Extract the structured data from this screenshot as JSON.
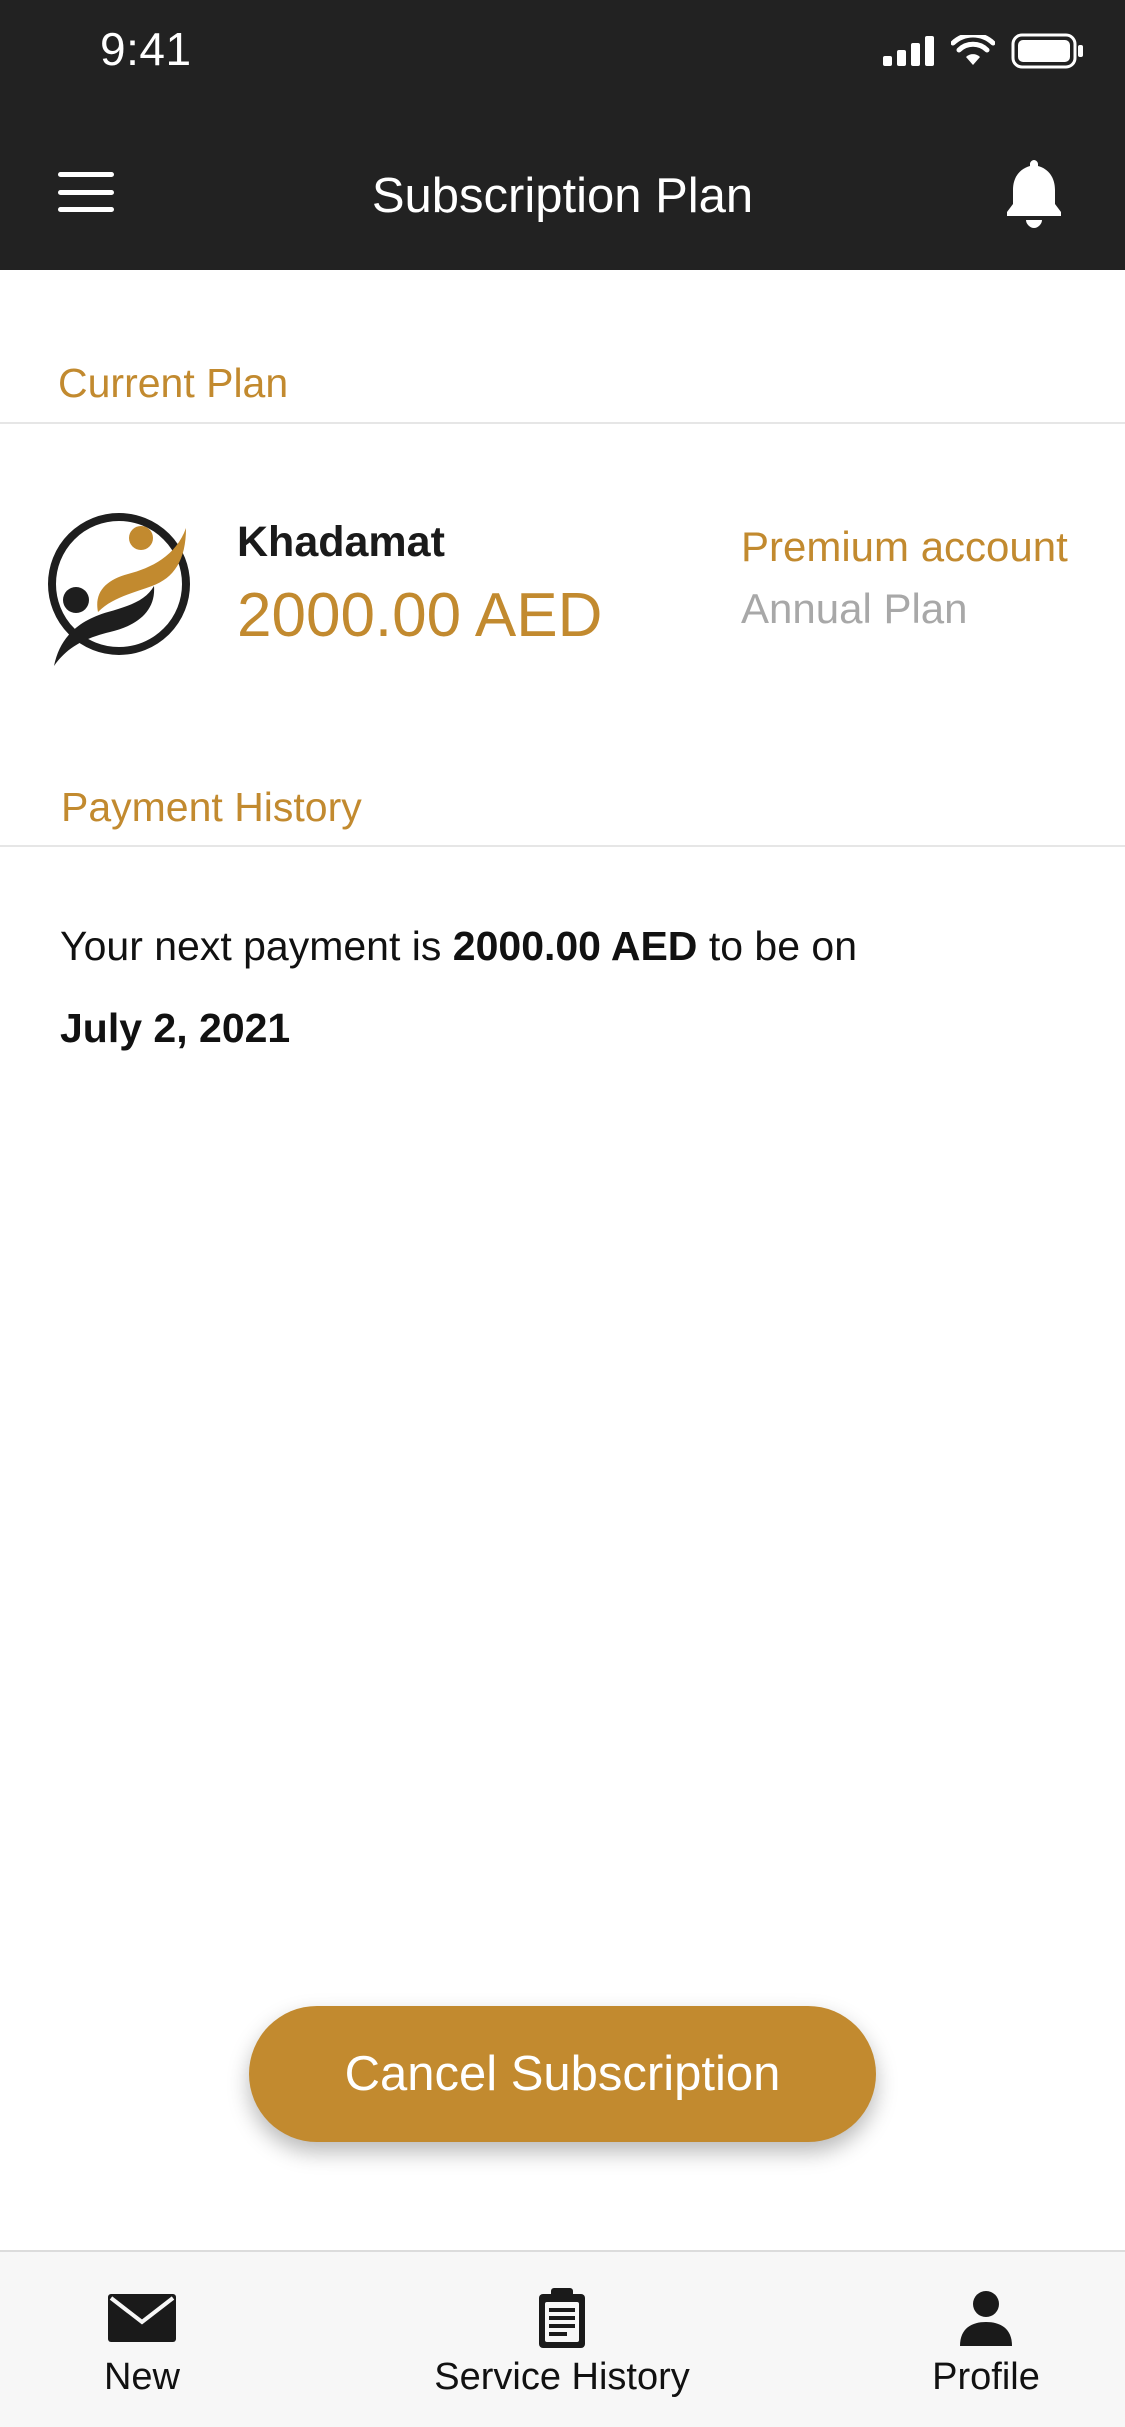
{
  "status_bar": {
    "time": "9:41",
    "icons": [
      "signal-icon",
      "wifi-icon",
      "battery-icon"
    ]
  },
  "header": {
    "title": "Subscription Plan",
    "menu_icon": "hamburger-menu-icon",
    "notification_icon": "bell-icon"
  },
  "current_plan": {
    "section_label": "Current Plan",
    "logo_icon": "khadamat-logo",
    "company": "Khadamat",
    "price": "2000.00 AED",
    "tier": "Premium account",
    "cycle": "Annual Plan"
  },
  "payment_history": {
    "section_label": "Payment History",
    "prefix": "Your next payment is",
    "amount": "2000.00 AED",
    "middle": "to be on",
    "date": "July 2, 2021"
  },
  "cancel_button": {
    "label": "Cancel Subscription"
  },
  "tabs": [
    {
      "label": "New",
      "icon": "envelope-icon"
    },
    {
      "label": "Service History",
      "icon": "clipboard-icon"
    },
    {
      "label": "Profile",
      "icon": "person-icon"
    }
  ],
  "colors": {
    "accent": "#c28a2f",
    "header_bg": "#222222",
    "muted_text": "#a8a8a8",
    "tabbar_bg": "#f7f7f7"
  }
}
